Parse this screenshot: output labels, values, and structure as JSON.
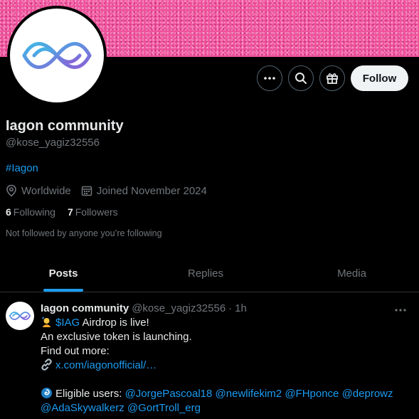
{
  "profile": {
    "name": "Iagon community",
    "handle": "@kose_yagiz32556",
    "hashtag": "#Iagon",
    "location": "Worldwide",
    "joined": "Joined November 2024",
    "following_count": "6",
    "following_label": "Following",
    "followers_count": "7",
    "followers_label": "Followers",
    "not_followed": "Not followed by anyone you’re following"
  },
  "actions": {
    "follow_label": "Follow",
    "icons": [
      "more-icon",
      "search-icon",
      "gift-icon"
    ]
  },
  "tabs": [
    {
      "label": "Posts",
      "active": true
    },
    {
      "label": "Replies",
      "active": false
    },
    {
      "label": "Media",
      "active": false
    }
  ],
  "post": {
    "author_name": "Iagon community",
    "author_handle": "@kose_yagiz32556",
    "separator": "·",
    "time": "1h",
    "cashtag": "$IAG",
    "line1_rest": " Airdrop is live!",
    "line2": "An exclusive token is launching.",
    "line3": "Find out more:",
    "link": "x.com/iagonofficial/…",
    "eligible_label": "Eligible users:",
    "mentions_line1": [
      "@JorgePascoal18",
      "@newlifekim2",
      "@FHponce",
      "@deprowz"
    ],
    "mentions_line2": [
      "@AdaSkywalkerz",
      "@GortTroll_erg"
    ]
  },
  "colors": {
    "accent": "#1d9bf0",
    "banner": "#f0529c",
    "muted": "#71767b"
  }
}
